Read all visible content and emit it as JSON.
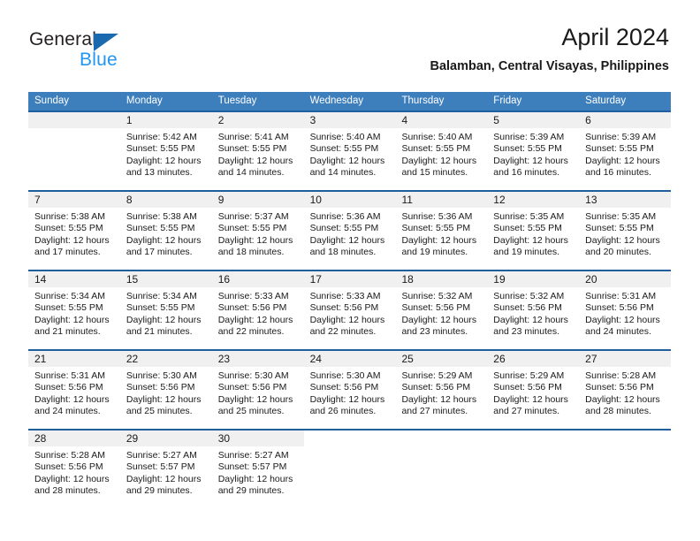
{
  "brand": {
    "name_top": "General",
    "name_bottom": "Blue",
    "triangle_color": "#1b6ab0",
    "blue_color": "#2196f3"
  },
  "header": {
    "title": "April 2024",
    "subtitle": "Balamban, Central Visayas, Philippines"
  },
  "theme": {
    "header_bg": "#3d7ebd",
    "separator": "#1f5fa0",
    "daynum_bg": "#f0f0f0"
  },
  "weekdays": [
    "Sunday",
    "Monday",
    "Tuesday",
    "Wednesday",
    "Thursday",
    "Friday",
    "Saturday"
  ],
  "weeks": [
    [
      {
        "day": "",
        "lines": []
      },
      {
        "day": "1",
        "lines": [
          "Sunrise: 5:42 AM",
          "Sunset: 5:55 PM",
          "Daylight: 12 hours",
          "and 13 minutes."
        ]
      },
      {
        "day": "2",
        "lines": [
          "Sunrise: 5:41 AM",
          "Sunset: 5:55 PM",
          "Daylight: 12 hours",
          "and 14 minutes."
        ]
      },
      {
        "day": "3",
        "lines": [
          "Sunrise: 5:40 AM",
          "Sunset: 5:55 PM",
          "Daylight: 12 hours",
          "and 14 minutes."
        ]
      },
      {
        "day": "4",
        "lines": [
          "Sunrise: 5:40 AM",
          "Sunset: 5:55 PM",
          "Daylight: 12 hours",
          "and 15 minutes."
        ]
      },
      {
        "day": "5",
        "lines": [
          "Sunrise: 5:39 AM",
          "Sunset: 5:55 PM",
          "Daylight: 12 hours",
          "and 16 minutes."
        ]
      },
      {
        "day": "6",
        "lines": [
          "Sunrise: 5:39 AM",
          "Sunset: 5:55 PM",
          "Daylight: 12 hours",
          "and 16 minutes."
        ]
      }
    ],
    [
      {
        "day": "7",
        "lines": [
          "Sunrise: 5:38 AM",
          "Sunset: 5:55 PM",
          "Daylight: 12 hours",
          "and 17 minutes."
        ]
      },
      {
        "day": "8",
        "lines": [
          "Sunrise: 5:38 AM",
          "Sunset: 5:55 PM",
          "Daylight: 12 hours",
          "and 17 minutes."
        ]
      },
      {
        "day": "9",
        "lines": [
          "Sunrise: 5:37 AM",
          "Sunset: 5:55 PM",
          "Daylight: 12 hours",
          "and 18 minutes."
        ]
      },
      {
        "day": "10",
        "lines": [
          "Sunrise: 5:36 AM",
          "Sunset: 5:55 PM",
          "Daylight: 12 hours",
          "and 18 minutes."
        ]
      },
      {
        "day": "11",
        "lines": [
          "Sunrise: 5:36 AM",
          "Sunset: 5:55 PM",
          "Daylight: 12 hours",
          "and 19 minutes."
        ]
      },
      {
        "day": "12",
        "lines": [
          "Sunrise: 5:35 AM",
          "Sunset: 5:55 PM",
          "Daylight: 12 hours",
          "and 19 minutes."
        ]
      },
      {
        "day": "13",
        "lines": [
          "Sunrise: 5:35 AM",
          "Sunset: 5:55 PM",
          "Daylight: 12 hours",
          "and 20 minutes."
        ]
      }
    ],
    [
      {
        "day": "14",
        "lines": [
          "Sunrise: 5:34 AM",
          "Sunset: 5:55 PM",
          "Daylight: 12 hours",
          "and 21 minutes."
        ]
      },
      {
        "day": "15",
        "lines": [
          "Sunrise: 5:34 AM",
          "Sunset: 5:55 PM",
          "Daylight: 12 hours",
          "and 21 minutes."
        ]
      },
      {
        "day": "16",
        "lines": [
          "Sunrise: 5:33 AM",
          "Sunset: 5:56 PM",
          "Daylight: 12 hours",
          "and 22 minutes."
        ]
      },
      {
        "day": "17",
        "lines": [
          "Sunrise: 5:33 AM",
          "Sunset: 5:56 PM",
          "Daylight: 12 hours",
          "and 22 minutes."
        ]
      },
      {
        "day": "18",
        "lines": [
          "Sunrise: 5:32 AM",
          "Sunset: 5:56 PM",
          "Daylight: 12 hours",
          "and 23 minutes."
        ]
      },
      {
        "day": "19",
        "lines": [
          "Sunrise: 5:32 AM",
          "Sunset: 5:56 PM",
          "Daylight: 12 hours",
          "and 23 minutes."
        ]
      },
      {
        "day": "20",
        "lines": [
          "Sunrise: 5:31 AM",
          "Sunset: 5:56 PM",
          "Daylight: 12 hours",
          "and 24 minutes."
        ]
      }
    ],
    [
      {
        "day": "21",
        "lines": [
          "Sunrise: 5:31 AM",
          "Sunset: 5:56 PM",
          "Daylight: 12 hours",
          "and 24 minutes."
        ]
      },
      {
        "day": "22",
        "lines": [
          "Sunrise: 5:30 AM",
          "Sunset: 5:56 PM",
          "Daylight: 12 hours",
          "and 25 minutes."
        ]
      },
      {
        "day": "23",
        "lines": [
          "Sunrise: 5:30 AM",
          "Sunset: 5:56 PM",
          "Daylight: 12 hours",
          "and 25 minutes."
        ]
      },
      {
        "day": "24",
        "lines": [
          "Sunrise: 5:30 AM",
          "Sunset: 5:56 PM",
          "Daylight: 12 hours",
          "and 26 minutes."
        ]
      },
      {
        "day": "25",
        "lines": [
          "Sunrise: 5:29 AM",
          "Sunset: 5:56 PM",
          "Daylight: 12 hours",
          "and 27 minutes."
        ]
      },
      {
        "day": "26",
        "lines": [
          "Sunrise: 5:29 AM",
          "Sunset: 5:56 PM",
          "Daylight: 12 hours",
          "and 27 minutes."
        ]
      },
      {
        "day": "27",
        "lines": [
          "Sunrise: 5:28 AM",
          "Sunset: 5:56 PM",
          "Daylight: 12 hours",
          "and 28 minutes."
        ]
      }
    ],
    [
      {
        "day": "28",
        "lines": [
          "Sunrise: 5:28 AM",
          "Sunset: 5:56 PM",
          "Daylight: 12 hours",
          "and 28 minutes."
        ]
      },
      {
        "day": "29",
        "lines": [
          "Sunrise: 5:27 AM",
          "Sunset: 5:57 PM",
          "Daylight: 12 hours",
          "and 29 minutes."
        ]
      },
      {
        "day": "30",
        "lines": [
          "Sunrise: 5:27 AM",
          "Sunset: 5:57 PM",
          "Daylight: 12 hours",
          "and 29 minutes."
        ]
      },
      {
        "day": "",
        "lines": []
      },
      {
        "day": "",
        "lines": []
      },
      {
        "day": "",
        "lines": []
      },
      {
        "day": "",
        "lines": []
      }
    ]
  ]
}
